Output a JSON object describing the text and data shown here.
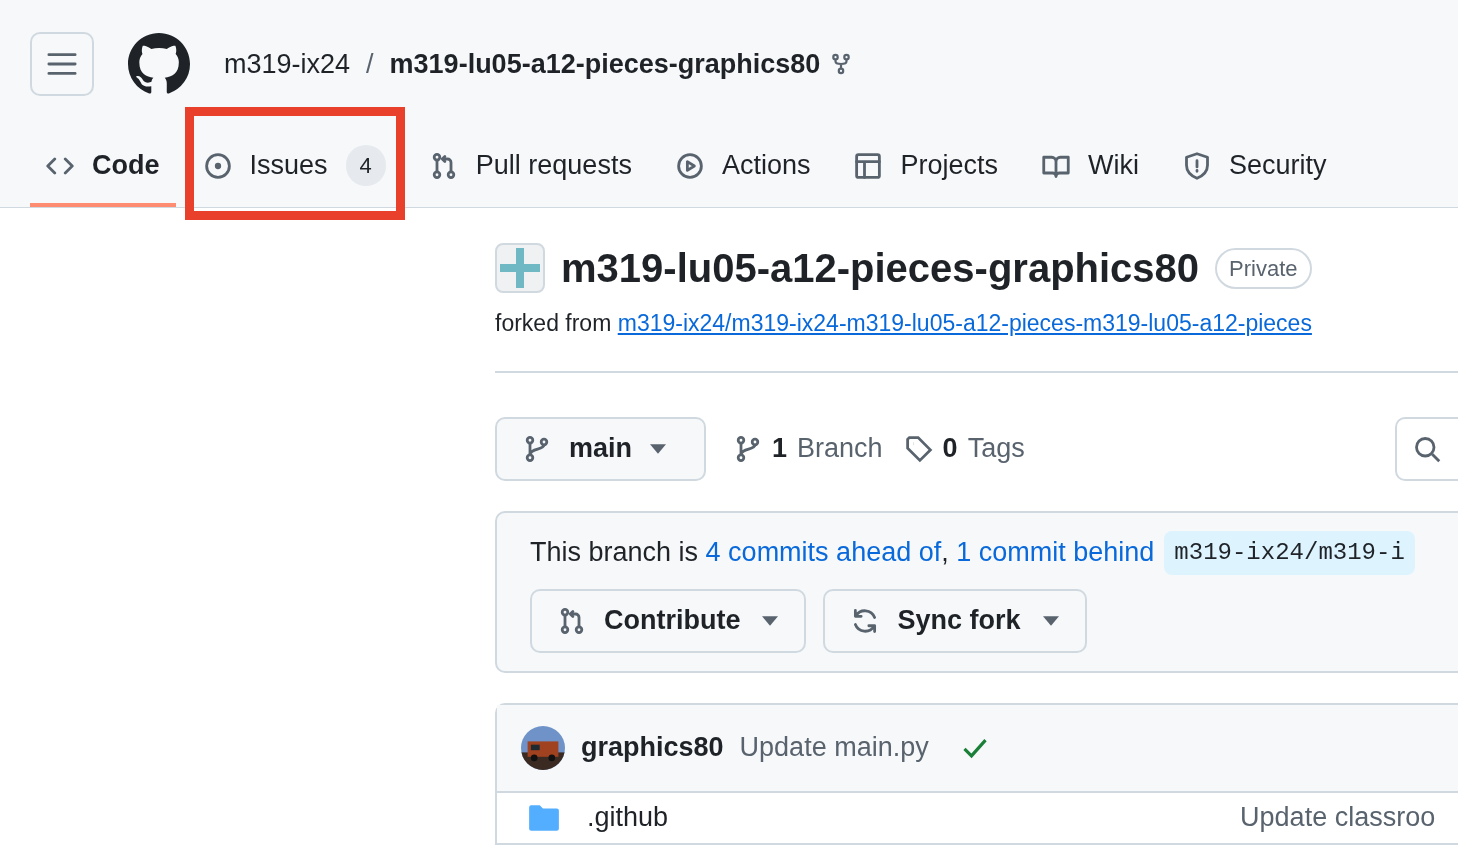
{
  "header": {
    "owner": "m319-ix24",
    "separator": "/",
    "repo": "m319-lu05-a12-pieces-graphics80"
  },
  "tabs": [
    {
      "label": "Code",
      "kind": "code",
      "selected": true,
      "highlighted": false
    },
    {
      "label": "Issues",
      "kind": "issue",
      "count": "4",
      "selected": false,
      "highlighted": true
    },
    {
      "label": "Pull requests",
      "kind": "pull",
      "selected": false,
      "highlighted": false
    },
    {
      "label": "Actions",
      "kind": "play",
      "selected": false,
      "highlighted": false
    },
    {
      "label": "Projects",
      "kind": "table",
      "selected": false,
      "highlighted": false
    },
    {
      "label": "Wiki",
      "kind": "book",
      "selected": false,
      "highlighted": false
    },
    {
      "label": "Security",
      "kind": "shield",
      "selected": false,
      "highlighted": false
    }
  ],
  "repo": {
    "name": "m319-lu05-a12-pieces-graphics80",
    "visibility": "Private",
    "forked_prefix": "forked from",
    "fork_source": "m319-ix24/m319-ix24-m319-lu05-a12-pieces-m319-lu05-a12-pieces"
  },
  "branch_bar": {
    "branch": "main",
    "branches_count": "1",
    "branches_label": "Branch",
    "tags_count": "0",
    "tags_label": "Tags"
  },
  "fork_status": {
    "prefix": "This branch is",
    "ahead": "4 commits ahead of",
    "separator": ",",
    "behind": "1 commit behind",
    "upstream": "m319-ix24/m319-i",
    "buttons": [
      {
        "label": "Contribute",
        "kind": "pull"
      },
      {
        "label": "Sync fork",
        "kind": "sync"
      }
    ]
  },
  "latest_commit": {
    "author": "graphics80",
    "message": "Update main.py",
    "checks_passed": true
  },
  "files": [
    {
      "name": ".github",
      "kind": "folder",
      "message": "Update classroo"
    }
  ]
}
